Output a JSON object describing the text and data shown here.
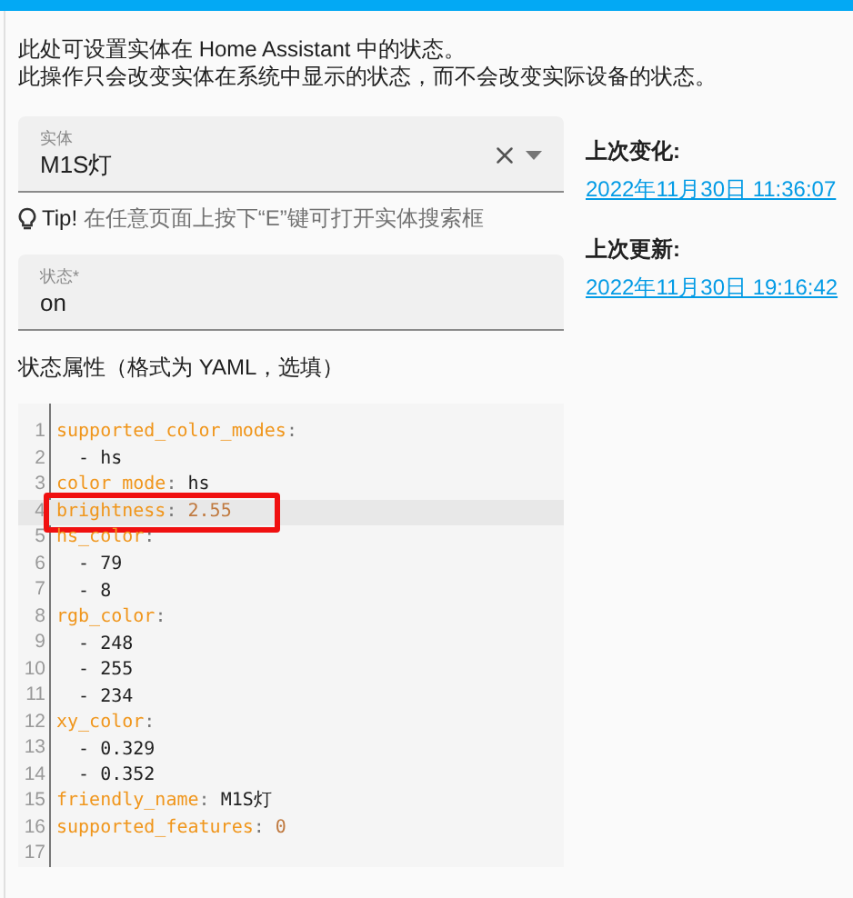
{
  "intro": [
    "此处可设置实体在 Home Assistant 中的状态。",
    "此操作只会改变实体在系统中显示的状态，而不会改变实际设备的状态。"
  ],
  "entity_field": {
    "label": "实体",
    "value": "M1S灯"
  },
  "tip": {
    "lead": "Tip!",
    "text": "在任意页面上按下“E”键可打开实体搜索框"
  },
  "state_field": {
    "label": "状态*",
    "value": "on"
  },
  "attributes_label": "状态属性（格式为 YAML，选填）",
  "code_lines": [
    {
      "number": "1",
      "kind": "key",
      "key": "supported_color_modes",
      "colon": ":",
      "active": false,
      "marked": false
    },
    {
      "number": "2",
      "kind": "item",
      "text": "  - hs",
      "active": false,
      "marked": false
    },
    {
      "number": "3",
      "kind": "key",
      "key": "color mode",
      "colon": ":",
      "value": " hs",
      "active": false,
      "marked": false
    },
    {
      "number": "4",
      "kind": "key_number",
      "key": "brightness",
      "colon": ":",
      "value": " 2.55",
      "active": true,
      "marked": true
    },
    {
      "number": "5",
      "kind": "key",
      "key": "hs_color",
      "colon": ":",
      "active": false,
      "marked": false
    },
    {
      "number": "6",
      "kind": "item",
      "text": "  - 79",
      "active": false,
      "marked": false
    },
    {
      "number": "7",
      "kind": "item",
      "text": "  - 8",
      "active": false,
      "marked": false
    },
    {
      "number": "8",
      "kind": "key",
      "key": "rgb_color",
      "colon": ":",
      "active": false,
      "marked": false
    },
    {
      "number": "9",
      "kind": "item",
      "text": "  - 248",
      "active": false,
      "marked": false
    },
    {
      "number": "10",
      "kind": "item",
      "text": "  - 255",
      "active": false,
      "marked": false
    },
    {
      "number": "11",
      "kind": "item",
      "text": "  - 234",
      "active": false,
      "marked": false
    },
    {
      "number": "12",
      "kind": "key",
      "key": "xy_color",
      "colon": ":",
      "active": false,
      "marked": false
    },
    {
      "number": "13",
      "kind": "item",
      "text": "  - 0.329",
      "active": false,
      "marked": false
    },
    {
      "number": "14",
      "kind": "item",
      "text": "  - 0.352",
      "active": false,
      "marked": false
    },
    {
      "number": "15",
      "kind": "key",
      "key": "friendly_name",
      "colon": ":",
      "value": " M1S灯",
      "active": false,
      "marked": false
    },
    {
      "number": "16",
      "kind": "key_number",
      "key": "supported_features",
      "colon": ":",
      "value": " 0",
      "active": false,
      "marked": false
    },
    {
      "number": "17",
      "kind": "blank",
      "active": false,
      "marked": false
    }
  ],
  "info": [
    {
      "title": "上次变化:",
      "link": "2022年11月30日 11:36:07"
    },
    {
      "title": "上次更新:",
      "link": "2022年11月30日 19:16:42"
    }
  ]
}
